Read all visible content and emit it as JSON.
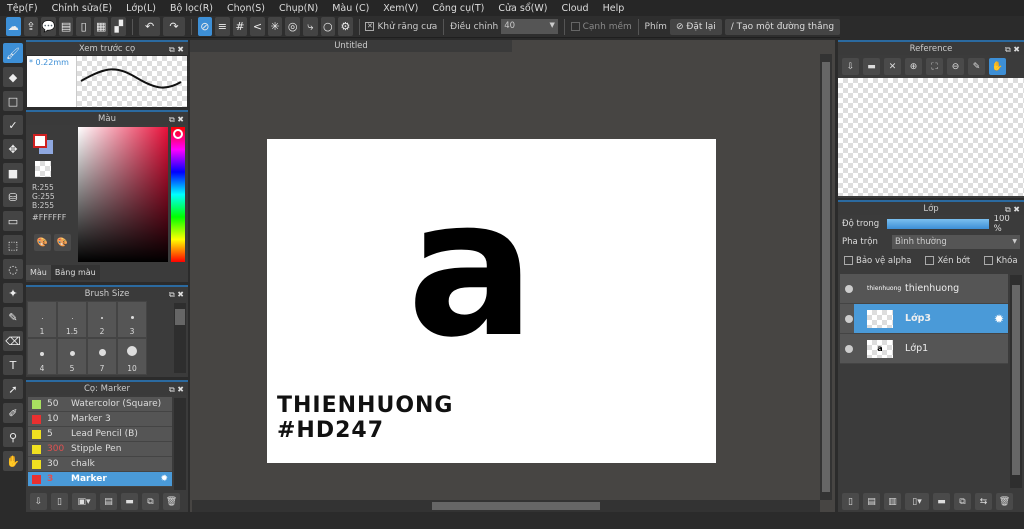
{
  "menu": [
    "Tệp(F)",
    "Chỉnh sửa(E)",
    "Lớp(L)",
    "Bộ lọc(R)",
    "Chọn(S)",
    "Chụp(N)",
    "Màu (C)",
    "Xem(V)",
    "Công cụ(T)",
    "Cửa sổ(W)",
    "Cloud",
    "Help"
  ],
  "toolbar": {
    "antialias_label": "Khử răng cưa",
    "adjust_label": "Điều chỉnh",
    "adjust_value": "40",
    "smooth_label": "Cạnh mềm",
    "key_label": "Phím",
    "reset_label": "Đặt lại",
    "line_label": "Tạo một đường thẳng"
  },
  "brush_preview": {
    "title": "Xem trước cọ",
    "size": "0.22mm"
  },
  "color": {
    "title": "Màu",
    "r": "R:255",
    "g": "G:255",
    "b": "B:255",
    "hex": "#FFFFFF",
    "tab_color": "Màu",
    "tab_palette": "Bảng màu",
    "primary": "#ffffff",
    "secondary": "#8fa8e0"
  },
  "brush_size": {
    "title": "Brush Size",
    "sizes": [
      "1",
      "1.5",
      "2",
      "3",
      "4",
      "5",
      "7",
      "10"
    ]
  },
  "brushes": {
    "title": "Cọ: Marker",
    "items": [
      {
        "size": "50",
        "name": "Watercolor (Square)",
        "color": "#a8e060"
      },
      {
        "size": "10",
        "name": "Marker 3",
        "color": "#e83030"
      },
      {
        "size": "5",
        "name": "Lead Pencil (B)",
        "color": "#f0e020"
      },
      {
        "size": "300",
        "name": "Stipple Pen",
        "color": "#f0e020"
      },
      {
        "size": "30",
        "name": "chalk",
        "color": "#f0e020"
      },
      {
        "size": "3",
        "name": "Marker",
        "color": "#e83030"
      }
    ]
  },
  "canvas": {
    "tab": "Untitled",
    "text1": "THIENHUONG",
    "text2": "#HD247",
    "glyph": "a"
  },
  "reference": {
    "title": "Reference"
  },
  "layers": {
    "title": "Lớp",
    "opacity_label": "Độ trong",
    "opacity_value": "100 %",
    "opacity": 1.0,
    "blend_label": "Pha trộn",
    "blend_value": "Bình thường",
    "protect_alpha": "Bảo vệ alpha",
    "clip": "Xén bớt",
    "lock": "Khóa",
    "items": [
      {
        "name": "thienhuong",
        "thumb": "thienhuong"
      },
      {
        "name": "Lớp3",
        "thumb": ""
      },
      {
        "name": "Lớp1",
        "thumb": "a"
      }
    ]
  }
}
